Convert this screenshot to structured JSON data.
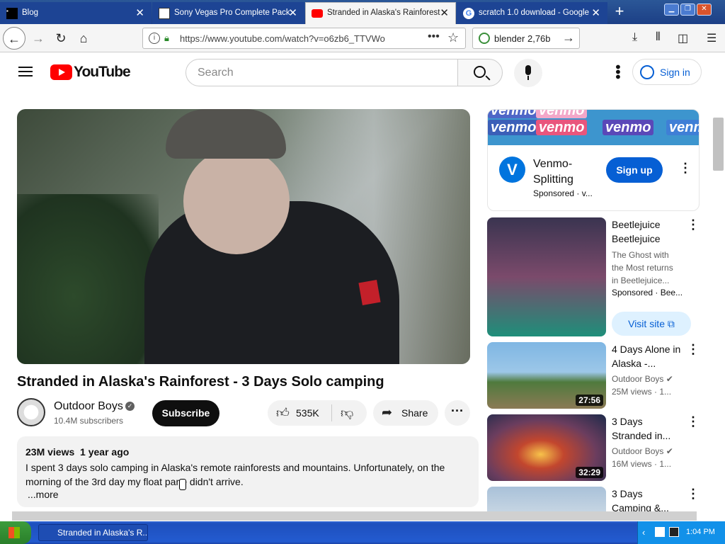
{
  "browser": {
    "tabs": [
      {
        "label": "Blog",
        "close": "✕"
      },
      {
        "label": "Sony Vegas Pro Complete Pack",
        "close": "✕"
      },
      {
        "label": "Stranded in Alaska's Rainforest",
        "close": "✕"
      },
      {
        "label": "scratch 1.0 download - Google",
        "close": "✕"
      }
    ],
    "new_tab": "+",
    "url": "https://www.youtube.com/watch?v=o6zb6_TTVWo",
    "search_value": "blender 2,76b"
  },
  "youtube": {
    "logo_text": "YouTube",
    "search_placeholder": "Search",
    "signin_label": "Sign in",
    "video": {
      "title": "Stranded in Alaska's Rainforest - 3 Days Solo camping",
      "channel": "Outdoor Boys",
      "subscribers": "10.4M subscribers",
      "subscribe_label": "Subscribe",
      "likes": "535K",
      "share_label": "Share",
      "views": "23M views",
      "age": "1 year ago",
      "description": "I spent 3 days solo camping in Alaska's remote rainforests and mountains. Unfortunately, on the morning of the 3rd day my float pane didn't arrive.",
      "more_label": "...more"
    },
    "ad": {
      "banner_word": "venmo",
      "title": "Venmo-Splitting",
      "sponsored": "Sponsored · v...",
      "cta": "Sign up"
    },
    "recommendations": [
      {
        "title": "Beetlejuice Beetlejuice",
        "description": "The Ghost with the Most returns in Beetlejuice...",
        "sponsored": "Sponsored · Bee...",
        "cta": "Visit site"
      },
      {
        "title": "4 Days Alone in Alaska -...",
        "channel": "Outdoor Boys",
        "views": "25M views · 1...",
        "duration": "27:56"
      },
      {
        "title": "3 Days Stranded in...",
        "channel": "Outdoor Boys",
        "views": "16M views · 1...",
        "duration": "32:29"
      },
      {
        "title": "3 Days Camping &...",
        "channel": "",
        "views": "",
        "duration": ""
      }
    ]
  },
  "taskbar": {
    "item": "Stranded in Alaska's R...",
    "time": "1:04 PM"
  }
}
